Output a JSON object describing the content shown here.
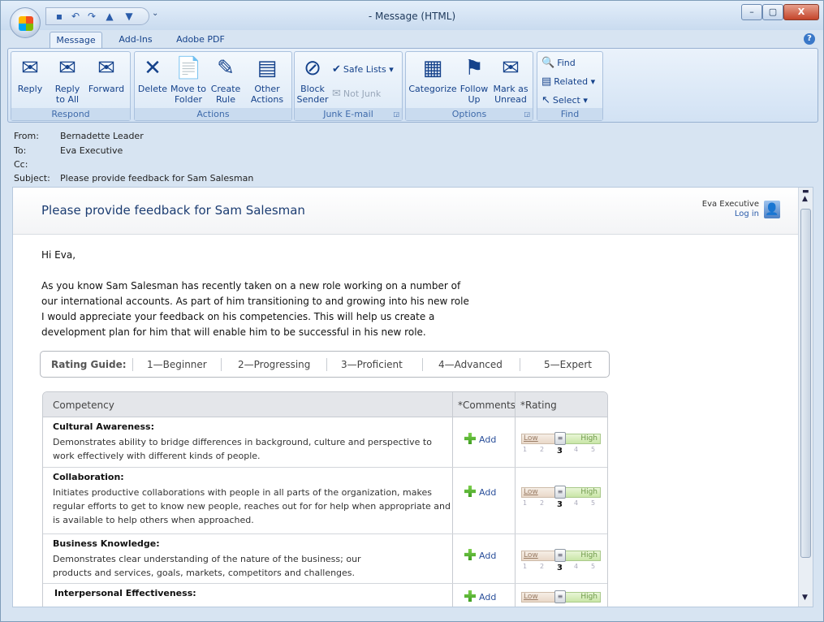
{
  "window": {
    "title": "- Message (HTML)",
    "controls": [
      "–",
      "▢",
      "X"
    ]
  },
  "qat": {
    "icons": [
      "save-icon",
      "undo-icon",
      "redo-icon",
      "previous-item-icon",
      "next-item-icon"
    ],
    "more": "⌄"
  },
  "tabs": [
    {
      "label": "Message",
      "selected": true
    },
    {
      "label": "Add-Ins",
      "selected": false
    },
    {
      "label": "Adobe PDF",
      "selected": false
    }
  ],
  "ribbon": {
    "respond": {
      "label": "Respond",
      "reply": "Reply",
      "reply_all": "Reply to All",
      "forward": "Forward"
    },
    "actions": {
      "label": "Actions",
      "delete": "Delete",
      "move_to_folder": "Move to Folder",
      "create_rule": "Create Rule",
      "other_actions": "Other Actions"
    },
    "junk": {
      "label": "Junk E-mail",
      "block_sender": "Block Sender",
      "safe_lists": "Safe Lists",
      "not_junk": "Not Junk"
    },
    "options": {
      "label": "Options",
      "categorize": "Categorize",
      "follow_up": "Follow Up",
      "mark_unread": "Mark as Unread"
    },
    "find": {
      "label": "Find",
      "find": "Find",
      "related": "Related",
      "select": "Select"
    }
  },
  "header": {
    "from_label": "From:",
    "from": "Bernadette Leader",
    "to_label": "To:",
    "to": "Eva Executive",
    "cc_label": "Cc:",
    "cc": "",
    "subject_label": "Subject:",
    "subject": "Please provide feedback for Sam Salesman"
  },
  "body": {
    "banner_title": "Please provide feedback for Sam Salesman",
    "user_name": "Eva Executive",
    "login": "Log in",
    "greeting": "Hi Eva,",
    "paragraph_lines": [
      "As you know Sam Salesman has recently taken on a new role working on a number of",
      "our international accounts. As part of him transitioning to and growing into his new role",
      "I would appreciate your feedback on his competencies. This will help us create a",
      "development plan for him that will enable him to be successful in his new role."
    ],
    "rating_guide": {
      "label": "Rating Guide:",
      "levels": [
        "1—Beginner",
        "2—Progressing",
        "3—Proficient",
        "4—Advanced",
        "5—Expert"
      ]
    },
    "table": {
      "headers": {
        "competency": "Competency",
        "comments": "*Comments",
        "rating": "*Rating"
      },
      "slider": {
        "low": "Low",
        "high": "High",
        "scale": [
          "1",
          "2",
          "3",
          "4",
          "5"
        ]
      },
      "rows": [
        {
          "title": "Cultural Awareness:",
          "desc": "Demonstrates ability to bridge differences in background, culture and perspective to work effectively with different kinds of people.",
          "add": "Add",
          "rating": 3
        },
        {
          "title": "Collaboration:",
          "desc": "Initiates productive collaborations with people in all parts of the organization, makes regular efforts to get to know new people, reaches out for for help when appropriate and is available to help others when approached.",
          "add": "Add",
          "rating": 3
        },
        {
          "title": "Business Knowledge:",
          "desc": "Demonstrates clear understanding of the nature of the business; our products and services, goals, markets, competitors and challenges.",
          "add": "Add",
          "rating": 3
        },
        {
          "title": "Interpersonal Effectiveness:",
          "desc": "",
          "add": "Add",
          "rating": null
        }
      ]
    }
  }
}
